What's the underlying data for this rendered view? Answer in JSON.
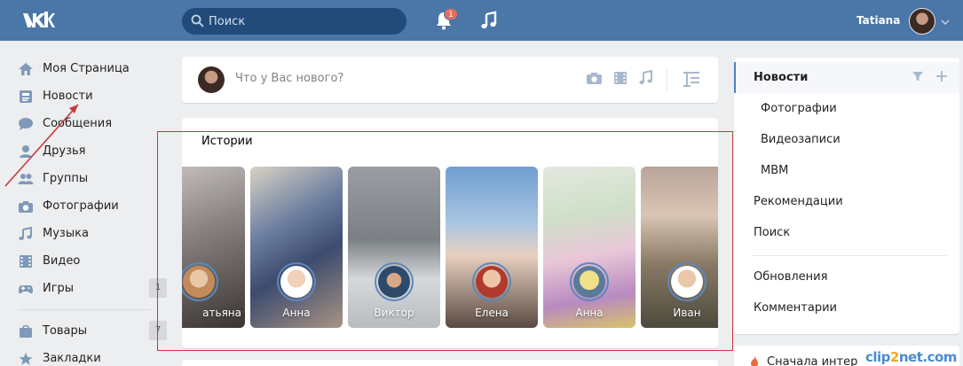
{
  "topbar": {
    "search_placeholder": "Поиск",
    "notifications_count": "1",
    "user_name": "Tatiana"
  },
  "leftnav": {
    "items": [
      {
        "label": "Моя Страница",
        "icon": "home-icon"
      },
      {
        "label": "Новости",
        "icon": "news-icon"
      },
      {
        "label": "Сообщения",
        "icon": "messages-icon"
      },
      {
        "label": "Друзья",
        "icon": "friends-icon"
      },
      {
        "label": "Группы",
        "icon": "groups-icon"
      },
      {
        "label": "Фотографии",
        "icon": "camera-icon"
      },
      {
        "label": "Музыка",
        "icon": "music-icon"
      },
      {
        "label": "Видео",
        "icon": "video-icon"
      },
      {
        "label": "Игры",
        "icon": "gamepad-icon"
      }
    ],
    "items2": [
      {
        "label": "Товары",
        "icon": "shopping-icon"
      },
      {
        "label": "Закладки",
        "icon": "star-icon"
      }
    ]
  },
  "post": {
    "placeholder": "Что у Вас нового?"
  },
  "stories": {
    "title": "Истории",
    "items": [
      {
        "name": "атьяна"
      },
      {
        "name": "Анна"
      },
      {
        "name": "Виктор"
      },
      {
        "name": "Елена"
      },
      {
        "name": "Анна"
      },
      {
        "name": "Иван"
      }
    ]
  },
  "rightmenu": {
    "items": [
      {
        "label": "Новости"
      },
      {
        "label": "Фотографии"
      },
      {
        "label": "Видеозаписи"
      },
      {
        "label": "МВМ"
      },
      {
        "label": "Рекомендации"
      },
      {
        "label": "Поиск"
      },
      {
        "label": "Обновления"
      },
      {
        "label": "Комментарии"
      }
    ],
    "bottom_label": "Сначала интер"
  },
  "watermark": {
    "part1": "clip",
    "part2": "2",
    "part3": "net.com"
  },
  "colors": {
    "brand": "#4a76a8",
    "accent": "#5181b8",
    "annotation": "#c6393f"
  }
}
